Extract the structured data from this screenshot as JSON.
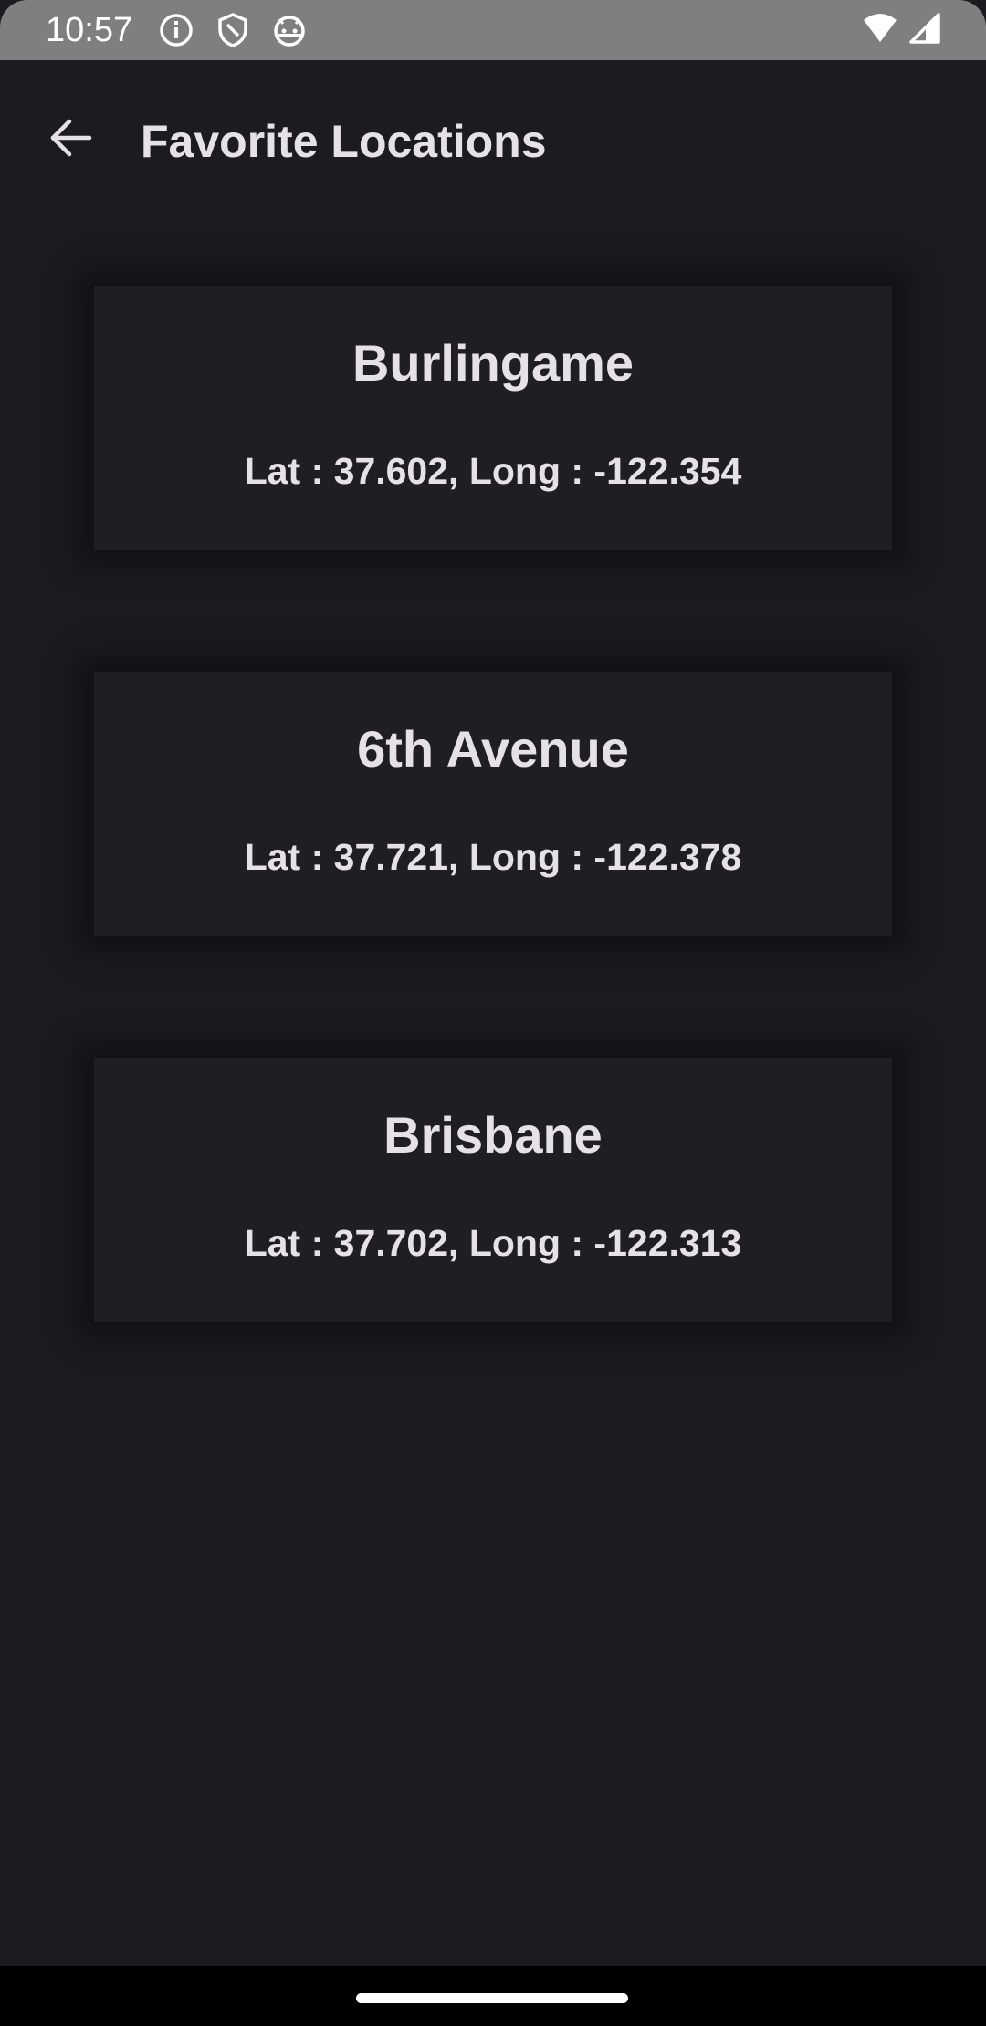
{
  "status_bar": {
    "time": "10:57",
    "icons": [
      "info-icon",
      "shield-icon",
      "android-icon",
      "wifi-icon",
      "signal-icon"
    ]
  },
  "app_bar": {
    "title": "Favorite Locations",
    "back_icon": "arrow-left-icon"
  },
  "locations": [
    {
      "name": "Burlingame",
      "coords": "Lat : 37.602, Long : -122.354"
    },
    {
      "name": "6th Avenue",
      "coords": "Lat : 37.721, Long : -122.378"
    },
    {
      "name": "Brisbane",
      "coords": "Lat : 37.702, Long : -122.313"
    }
  ],
  "colors": {
    "background": "#1c1b20",
    "card": "#1f1e23",
    "text": "#e6e1e6",
    "status_bar": "#7f7f7f"
  }
}
